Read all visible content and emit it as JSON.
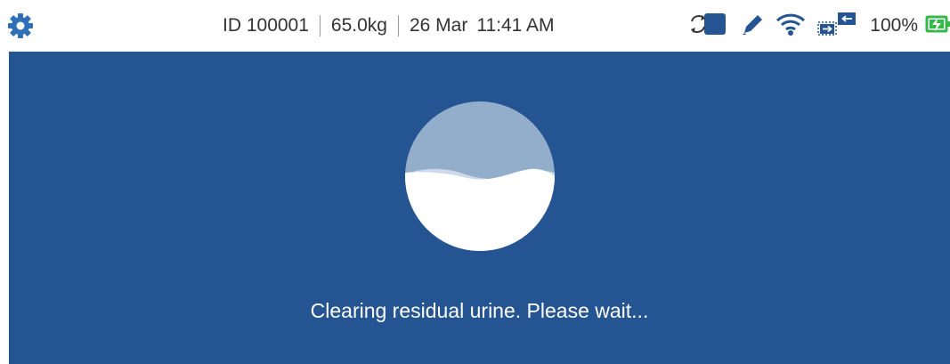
{
  "status_bar": {
    "patient_id": "ID 100001",
    "weight": "65.0kg",
    "date": "26 Mar",
    "time": "11:41 AM",
    "battery_percent": "100%",
    "icons": [
      "gear-icon",
      "sync-device-icon",
      "pencil-icon",
      "wifi-icon",
      "data-transfer-icon",
      "battery-charging-icon"
    ]
  },
  "main": {
    "message": "Clearing residual urine. Please wait..."
  },
  "colors": {
    "accent": "#2f6fb7",
    "background": "#245491",
    "battery": "#34b84a"
  }
}
